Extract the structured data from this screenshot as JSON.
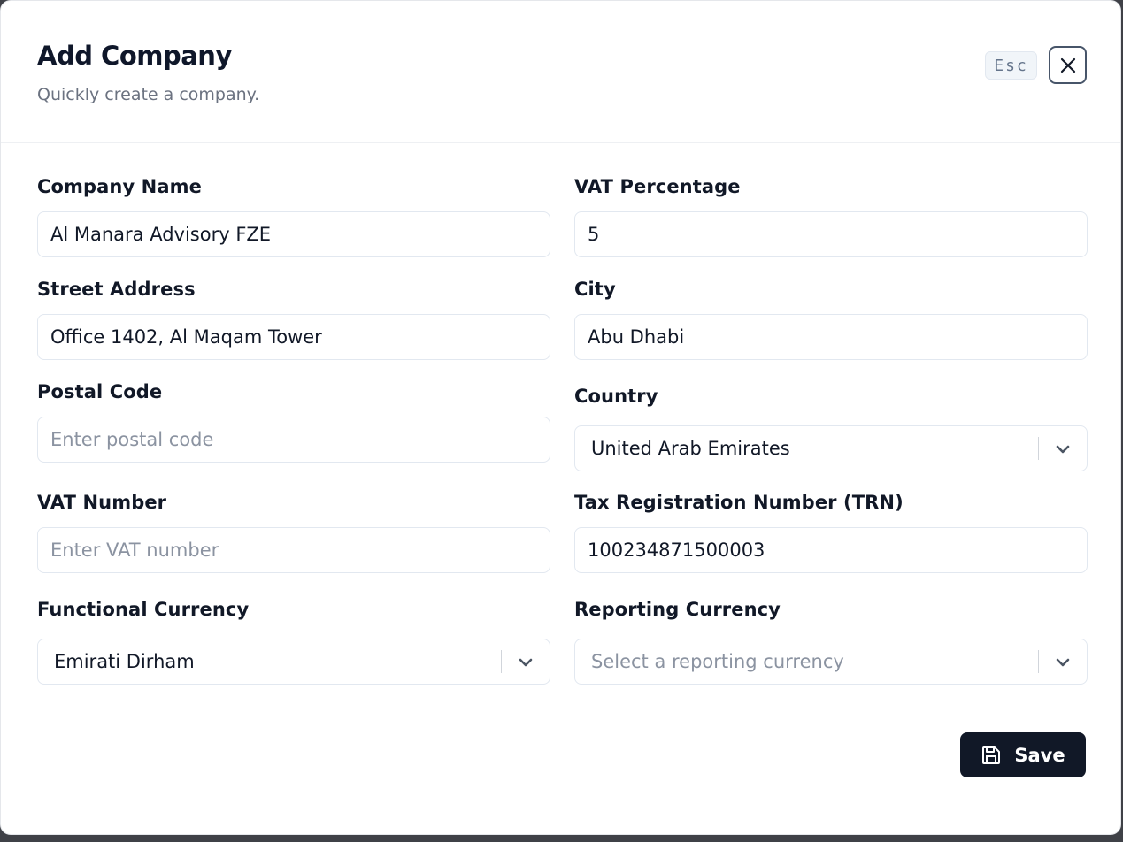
{
  "dialog": {
    "title": "Add Company",
    "subtitle": "Quickly create a company.",
    "esc_hint": "Esc",
    "close_icon": "close-icon"
  },
  "form": {
    "company_name": {
      "label": "Company Name",
      "value": "Al Manara Advisory FZE",
      "placeholder": ""
    },
    "vat_percentage": {
      "label": "VAT Percentage",
      "value": "5",
      "placeholder": ""
    },
    "street_address": {
      "label": "Street Address",
      "value": "Office 1402, Al Maqam Tower",
      "placeholder": ""
    },
    "city": {
      "label": "City",
      "value": "Abu Dhabi",
      "placeholder": ""
    },
    "postal_code": {
      "label": "Postal Code",
      "value": "",
      "placeholder": "Enter postal code"
    },
    "country": {
      "label": "Country",
      "value": "United Arab Emirates"
    },
    "vat_number": {
      "label": "VAT Number",
      "value": "",
      "placeholder": "Enter VAT number"
    },
    "trn": {
      "label": "Tax Registration Number (TRN)",
      "value": "100234871500003",
      "placeholder": ""
    },
    "functional_currency": {
      "label": "Functional Currency",
      "value": "Emirati Dirham"
    },
    "reporting_currency": {
      "label": "Reporting Currency",
      "placeholder": "Select a reporting currency"
    }
  },
  "actions": {
    "save_label": "Save",
    "save_icon": "save-icon"
  },
  "colors": {
    "primary_button": "#111827",
    "border": "#e2e8f0",
    "muted_text": "#6b7280"
  }
}
